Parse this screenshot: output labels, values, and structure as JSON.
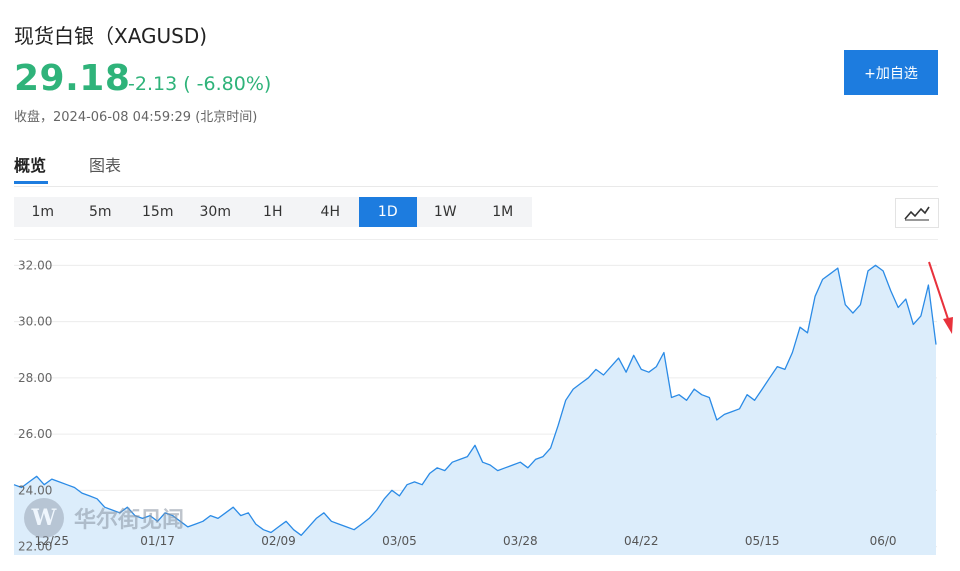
{
  "header": {
    "title": "现货白银（XAGUSD)",
    "price": "29.18",
    "change": "-2.13 ( -6.80%)",
    "status": "收盘，2024-06-08 04:59:29 (北京时间)",
    "add_button": "+加自选",
    "up_down_color": "#2fb37a",
    "accent_color": "#1d7cdf"
  },
  "tabs": [
    {
      "label": "概览",
      "active": true
    },
    {
      "label": "图表",
      "active": false
    }
  ],
  "intervals": [
    {
      "label": "1m",
      "active": false
    },
    {
      "label": "5m",
      "active": false
    },
    {
      "label": "15m",
      "active": false
    },
    {
      "label": "30m",
      "active": false
    },
    {
      "label": "1H",
      "active": false
    },
    {
      "label": "4H",
      "active": false
    },
    {
      "label": "1D",
      "active": true
    },
    {
      "label": "1W",
      "active": false
    },
    {
      "label": "1M",
      "active": false
    }
  ],
  "chart_type_icon": "line-chart-icon",
  "watermark": {
    "logo_letter": "W",
    "text": "华尔街见闻"
  },
  "annotation": {
    "type": "arrow",
    "color": "#e8323c"
  },
  "chart_data": {
    "type": "area",
    "title": "",
    "xlabel": "",
    "ylabel": "",
    "ylim": [
      21.7,
      32.9
    ],
    "yticks": [
      "22.00",
      "24.00",
      "26.00",
      "28.00",
      "30.00",
      "32.00"
    ],
    "xticks": [
      {
        "index": 5,
        "label": "12/25"
      },
      {
        "index": 19,
        "label": "01/17"
      },
      {
        "index": 35,
        "label": "02/09"
      },
      {
        "index": 51,
        "label": "03/05"
      },
      {
        "index": 67,
        "label": "03/28"
      },
      {
        "index": 83,
        "label": "04/22"
      },
      {
        "index": 99,
        "label": "05/15"
      },
      {
        "index": 115,
        "label": "06/0"
      }
    ],
    "grid": true,
    "line_color": "#2b8be6",
    "fill_color": "#dcedfb",
    "values": [
      24.2,
      24.1,
      24.3,
      24.5,
      24.2,
      24.4,
      24.3,
      24.2,
      24.1,
      23.9,
      23.8,
      23.7,
      23.4,
      23.3,
      23.2,
      23.4,
      23.1,
      23.0,
      23.1,
      22.9,
      23.2,
      23.1,
      22.9,
      22.7,
      22.8,
      22.9,
      23.1,
      23.0,
      23.2,
      23.4,
      23.1,
      23.2,
      22.8,
      22.6,
      22.5,
      22.7,
      22.9,
      22.6,
      22.4,
      22.7,
      23.0,
      23.2,
      22.9,
      22.8,
      22.7,
      22.6,
      22.8,
      23.0,
      23.3,
      23.7,
      24.0,
      23.8,
      24.2,
      24.3,
      24.2,
      24.6,
      24.8,
      24.7,
      25.0,
      25.1,
      25.2,
      25.6,
      25.0,
      24.9,
      24.7,
      24.8,
      24.9,
      25.0,
      24.8,
      25.1,
      25.2,
      25.5,
      26.3,
      27.2,
      27.6,
      27.8,
      28.0,
      28.3,
      28.1,
      28.4,
      28.7,
      28.2,
      28.8,
      28.3,
      28.2,
      28.4,
      28.9,
      27.3,
      27.4,
      27.2,
      27.6,
      27.4,
      27.3,
      26.5,
      26.7,
      26.8,
      26.9,
      27.4,
      27.2,
      27.6,
      28.0,
      28.4,
      28.3,
      28.9,
      29.8,
      29.6,
      30.9,
      31.5,
      31.7,
      31.9,
      30.6,
      30.3,
      30.6,
      31.8,
      32.0,
      31.8,
      31.1,
      30.5,
      30.8,
      29.9,
      30.2,
      31.3,
      29.18
    ]
  }
}
